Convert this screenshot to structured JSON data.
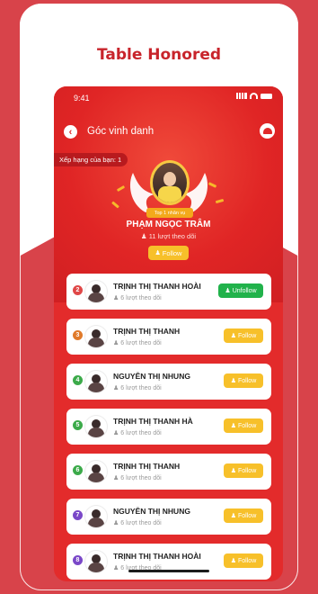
{
  "heading": "Table Honored",
  "status": {
    "time": "9:41"
  },
  "nav": {
    "title": "Góc vinh danh"
  },
  "rank_pill": "Xếp hạng của bạn: 1",
  "winner": {
    "ribbon": "Top 1 nhân vụ",
    "name": "PHẠM NGỌC TRÂM",
    "followers": "11 lượt theo dõi",
    "follow_label": "Follow"
  },
  "rows": [
    {
      "rank": "2",
      "name": "TRỊNH THỊ THANH HOÀI",
      "followers": "6 lượt theo dõi",
      "button": "Unfollow"
    },
    {
      "rank": "3",
      "name": "TRỊNH THỊ THANH",
      "followers": "6 lượt theo dõi",
      "button": "Follow"
    },
    {
      "rank": "4",
      "name": "NGUYỄN THỊ NHUNG",
      "followers": "6 lượt theo dõi",
      "button": "Follow"
    },
    {
      "rank": "5",
      "name": "TRỊNH THỊ THANH HÀ",
      "followers": "6 lượt theo dõi",
      "button": "Follow"
    },
    {
      "rank": "6",
      "name": "TRỊNH THỊ THANH",
      "followers": "6 lượt theo dõi",
      "button": "Follow"
    },
    {
      "rank": "7",
      "name": "NGUYỄN THỊ NHUNG",
      "followers": "6 lượt theo dõi",
      "button": "Follow"
    },
    {
      "rank": "8",
      "name": "TRỊNH THỊ THANH HOÀI",
      "followers": "6 lượt theo dõi",
      "button": "Follow"
    }
  ],
  "colors": {
    "background": "#d8434a",
    "heading": "#c8242b",
    "follow": "#f7c02a",
    "unfollow": "#21b24b",
    "medal_colors": [
      "#e04848",
      "#e07a2a",
      "#3caa4a",
      "#3caa4a",
      "#3caa4a",
      "#7a48c8",
      "#7a48c8"
    ]
  }
}
